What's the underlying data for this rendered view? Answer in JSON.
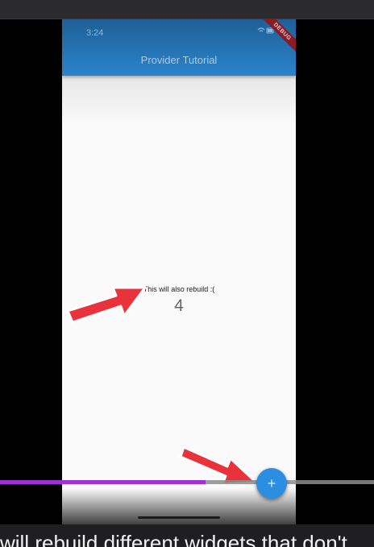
{
  "status_bar": {
    "time": "3:24",
    "icons": "wifi-icon battery-icon"
  },
  "debug_banner": "DEBUG",
  "app_bar": {
    "title": "Provider Tutorial"
  },
  "content": {
    "label": "This will also rebuild :(",
    "count": "4"
  },
  "fab": {
    "symbol": "+"
  },
  "video": {
    "progress_percent": 55
  },
  "caption": {
    "text": "will rebuild different widgets that don't"
  },
  "colors": {
    "app_bar": "#2a84cc",
    "fab": "#2a8fe0",
    "progress": "#a02fd6",
    "arrow": "#e8323c"
  }
}
